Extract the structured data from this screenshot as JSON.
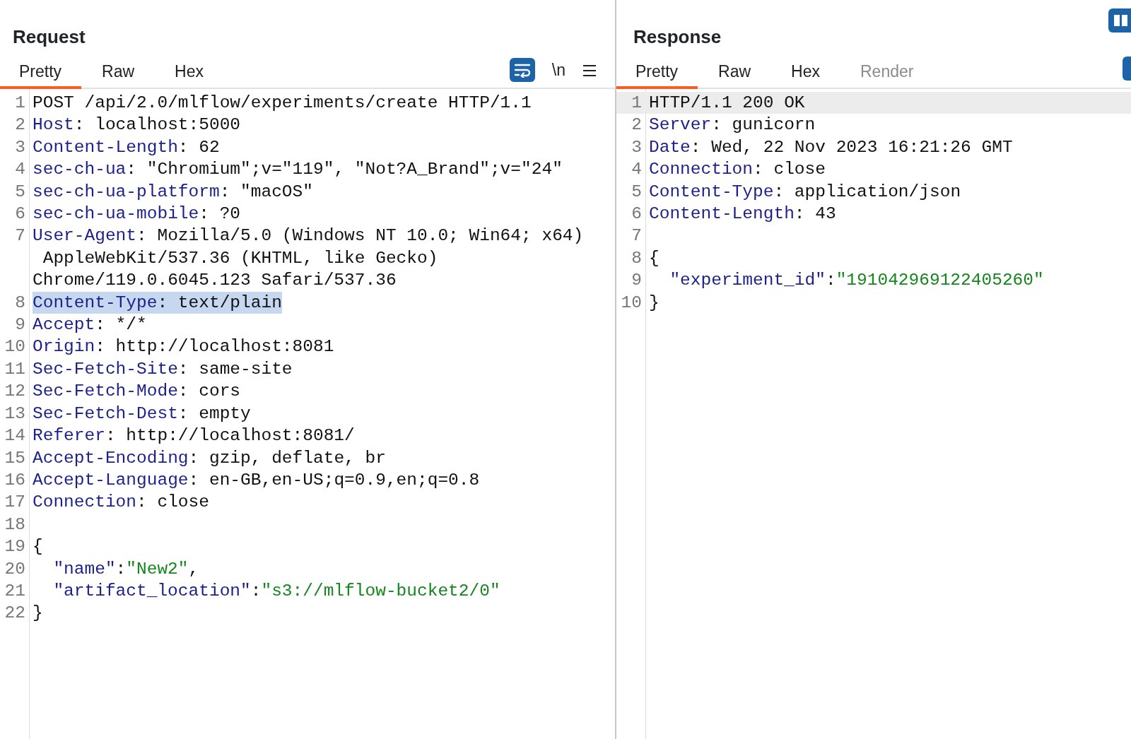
{
  "panes": [
    {
      "title": "Request",
      "tabs": [
        {
          "label": "Pretty",
          "selected": true,
          "disabled": false
        },
        {
          "label": "Raw",
          "selected": false,
          "disabled": false
        },
        {
          "label": "Hex",
          "selected": false,
          "disabled": false
        }
      ],
      "toolbar": [
        {
          "kind": "wrap",
          "on": true
        },
        {
          "kind": "newline",
          "label": "\\n"
        },
        {
          "kind": "menu"
        }
      ],
      "lines": [
        {
          "num": "1",
          "parts": [
            {
              "kind": "plain",
              "text": "POST /api/2.0/mlflow/experiments/create HTTP/1.1"
            }
          ]
        },
        {
          "num": "2",
          "parts": [
            {
              "kind": "key",
              "text": "Host"
            },
            {
              "kind": "plain",
              "text": ": localhost:5000"
            }
          ]
        },
        {
          "num": "3",
          "parts": [
            {
              "kind": "key",
              "text": "Content-Length"
            },
            {
              "kind": "plain",
              "text": ": 62"
            }
          ]
        },
        {
          "num": "4",
          "parts": [
            {
              "kind": "key",
              "text": "sec-ch-ua"
            },
            {
              "kind": "plain",
              "text": ": \"Chromium\";v=\"119\", \"Not?A_Brand\";v=\"24\""
            }
          ]
        },
        {
          "num": "5",
          "parts": [
            {
              "kind": "key",
              "text": "sec-ch-ua-platform"
            },
            {
              "kind": "plain",
              "text": ": \"macOS\""
            }
          ]
        },
        {
          "num": "6",
          "parts": [
            {
              "kind": "key",
              "text": "sec-ch-ua-mobile"
            },
            {
              "kind": "plain",
              "text": ": ?0"
            }
          ]
        },
        {
          "num": "7",
          "parts": [
            {
              "kind": "key",
              "text": "User-Agent"
            },
            {
              "kind": "plain",
              "text": ": Mozilla/5.0 (Windows NT 10.0; Win64; x64)"
            }
          ],
          "wrapped": [
            " AppleWebKit/537.36 (KHTML, like Gecko)",
            "Chrome/119.0.6045.123 Safari/537.36"
          ]
        },
        {
          "num": "8",
          "selected": true,
          "parts": [
            {
              "kind": "key",
              "text": "Content-Type"
            },
            {
              "kind": "plain",
              "text": ": text/plain"
            }
          ]
        },
        {
          "num": "9",
          "parts": [
            {
              "kind": "key",
              "text": "Accept"
            },
            {
              "kind": "plain",
              "text": ": */*"
            }
          ]
        },
        {
          "num": "10",
          "parts": [
            {
              "kind": "key",
              "text": "Origin"
            },
            {
              "kind": "plain",
              "text": ": http://localhost:8081"
            }
          ]
        },
        {
          "num": "11",
          "parts": [
            {
              "kind": "key",
              "text": "Sec-Fetch-Site"
            },
            {
              "kind": "plain",
              "text": ": same-site"
            }
          ]
        },
        {
          "num": "12",
          "parts": [
            {
              "kind": "key",
              "text": "Sec-Fetch-Mode"
            },
            {
              "kind": "plain",
              "text": ": cors"
            }
          ]
        },
        {
          "num": "13",
          "parts": [
            {
              "kind": "key",
              "text": "Sec-Fetch-Dest"
            },
            {
              "kind": "plain",
              "text": ": empty"
            }
          ]
        },
        {
          "num": "14",
          "parts": [
            {
              "kind": "key",
              "text": "Referer"
            },
            {
              "kind": "plain",
              "text": ": http://localhost:8081/"
            }
          ]
        },
        {
          "num": "15",
          "parts": [
            {
              "kind": "key",
              "text": "Accept-Encoding"
            },
            {
              "kind": "plain",
              "text": ": gzip, deflate, br"
            }
          ]
        },
        {
          "num": "16",
          "parts": [
            {
              "kind": "key",
              "text": "Accept-Language"
            },
            {
              "kind": "plain",
              "text": ": en-GB,en-US;q=0.9,en;q=0.8"
            }
          ]
        },
        {
          "num": "17",
          "parts": [
            {
              "kind": "key",
              "text": "Connection"
            },
            {
              "kind": "plain",
              "text": ": close"
            }
          ]
        },
        {
          "num": "18"
        },
        {
          "num": "19",
          "parts": [
            {
              "kind": "plain",
              "text": "{"
            }
          ]
        },
        {
          "num": "20",
          "indent": true,
          "parts": [
            {
              "kind": "key",
              "text": "\"name\""
            },
            {
              "kind": "plain",
              "text": ":"
            },
            {
              "kind": "string",
              "text": "\"New2\""
            },
            {
              "kind": "plain",
              "text": ","
            }
          ]
        },
        {
          "num": "21",
          "indent": true,
          "parts": [
            {
              "kind": "key",
              "text": "\"artifact_location\""
            },
            {
              "kind": "plain",
              "text": ":"
            },
            {
              "kind": "string",
              "text": "\"s3://mlflow-bucket2/0\""
            }
          ]
        },
        {
          "num": "22",
          "parts": [
            {
              "kind": "plain",
              "text": "}"
            }
          ]
        }
      ]
    },
    {
      "title": "Response",
      "tabs": [
        {
          "label": "Pretty",
          "selected": true,
          "disabled": false
        },
        {
          "label": "Raw",
          "selected": false,
          "disabled": false
        },
        {
          "label": "Hex",
          "selected": false,
          "disabled": false
        },
        {
          "label": "Render",
          "selected": false,
          "disabled": true
        }
      ],
      "toolbar": [
        {
          "kind": "wrap",
          "on": true
        }
      ],
      "lines": [
        {
          "num": "1",
          "current": true,
          "parts": [
            {
              "kind": "plain",
              "text": "HTTP/1.1 200 OK"
            }
          ]
        },
        {
          "num": "2",
          "parts": [
            {
              "kind": "key",
              "text": "Server"
            },
            {
              "kind": "plain",
              "text": ": gunicorn"
            }
          ]
        },
        {
          "num": "3",
          "parts": [
            {
              "kind": "key",
              "text": "Date"
            },
            {
              "kind": "plain",
              "text": ": Wed, 22 Nov 2023 16:21:26 GMT"
            }
          ]
        },
        {
          "num": "4",
          "parts": [
            {
              "kind": "key",
              "text": "Connection"
            },
            {
              "kind": "plain",
              "text": ": close"
            }
          ]
        },
        {
          "num": "5",
          "parts": [
            {
              "kind": "key",
              "text": "Content-Type"
            },
            {
              "kind": "plain",
              "text": ": application/json"
            }
          ]
        },
        {
          "num": "6",
          "parts": [
            {
              "kind": "key",
              "text": "Content-Length"
            },
            {
              "kind": "plain",
              "text": ": 43"
            }
          ]
        },
        {
          "num": "7"
        },
        {
          "num": "8",
          "parts": [
            {
              "kind": "plain",
              "text": "{"
            }
          ]
        },
        {
          "num": "9",
          "indent": true,
          "parts": [
            {
              "kind": "key",
              "text": "\"experiment_id\""
            },
            {
              "kind": "plain",
              "text": ":"
            },
            {
              "kind": "string",
              "text": "\"191042969122405260\""
            }
          ]
        },
        {
          "num": "10",
          "parts": [
            {
              "kind": "plain",
              "text": "}"
            }
          ]
        }
      ]
    }
  ]
}
